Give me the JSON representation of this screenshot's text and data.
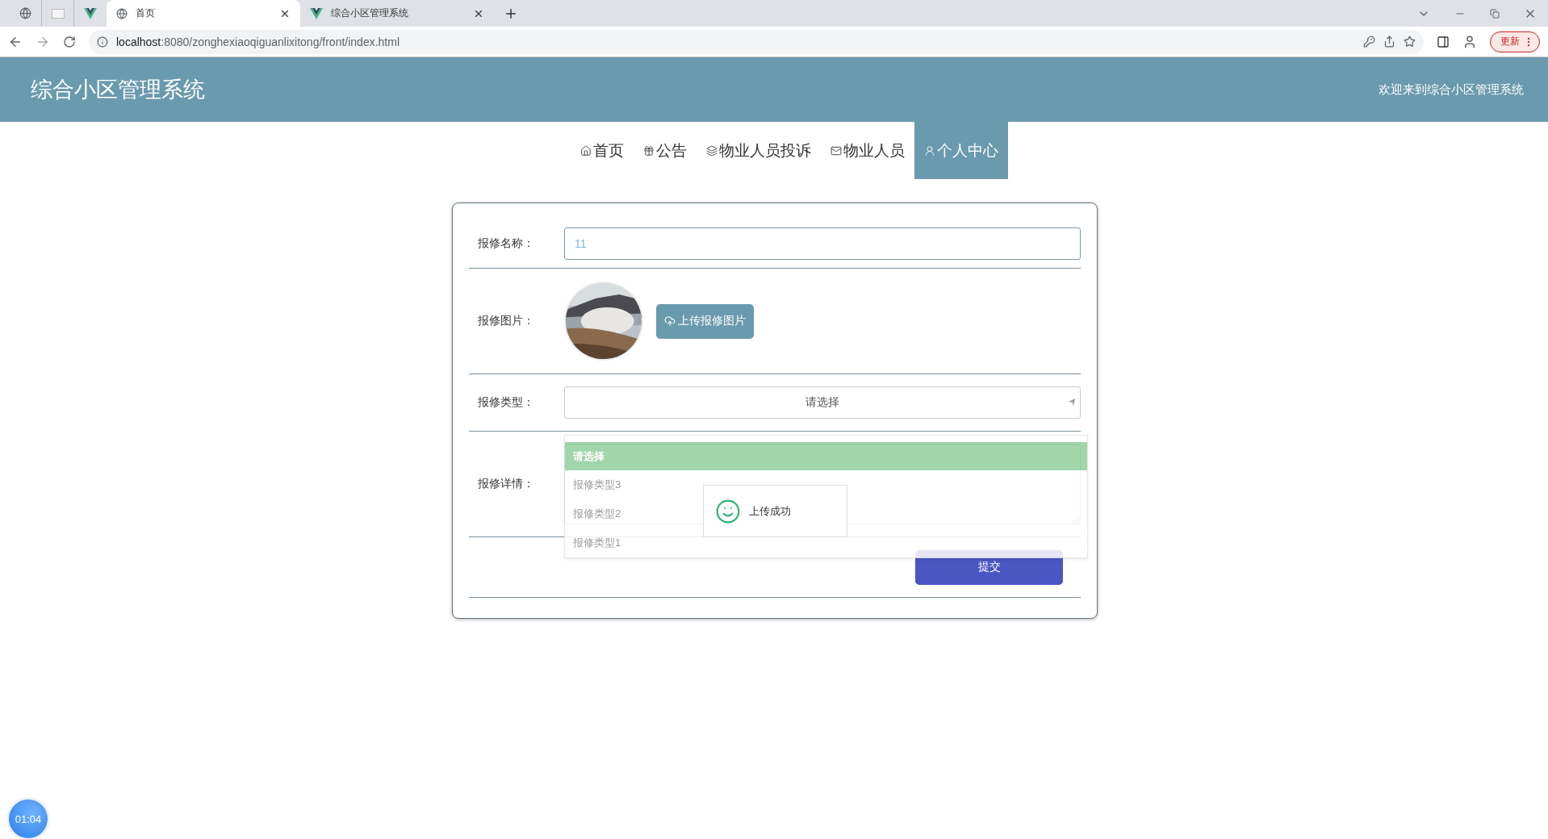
{
  "browser": {
    "tabs": [
      {
        "title": "首页",
        "selected": true
      },
      {
        "title": "综合小区管理系统",
        "selected": false
      }
    ],
    "url_host": "localhost",
    "url_rest": ":8080/zonghexiaoqiguanlixitong/front/index.html",
    "update_button": "更新"
  },
  "header": {
    "title": "综合小区管理系统",
    "welcome": "欢迎来到综合小区管理系统"
  },
  "nav": {
    "items": [
      {
        "label": "首页",
        "selected": false
      },
      {
        "label": "公告",
        "selected": false
      },
      {
        "label": "物业人员投诉",
        "selected": false
      },
      {
        "label": "物业人员",
        "selected": false
      },
      {
        "label": "个人中心",
        "selected": true
      }
    ]
  },
  "form": {
    "fields": [
      {
        "kind": "text",
        "label": "报修名称：",
        "value": "11"
      },
      {
        "label": "报修图片：",
        "button": "上传报修图片"
      },
      {
        "kind": "select",
        "label": "报修类型：",
        "value": "请选择",
        "expanded": true,
        "options": [
          {
            "label": "请选择",
            "selected": true
          },
          {
            "label": "报修类型3",
            "selected": false
          },
          {
            "label": "报修类型2",
            "selected": false
          },
          {
            "label": "报修类型1",
            "selected": false
          }
        ]
      },
      {
        "kind": "textarea",
        "label": "报修详情："
      }
    ],
    "submit": "提交"
  },
  "toast": {
    "message": "上传成功"
  },
  "timer": "01:04"
}
